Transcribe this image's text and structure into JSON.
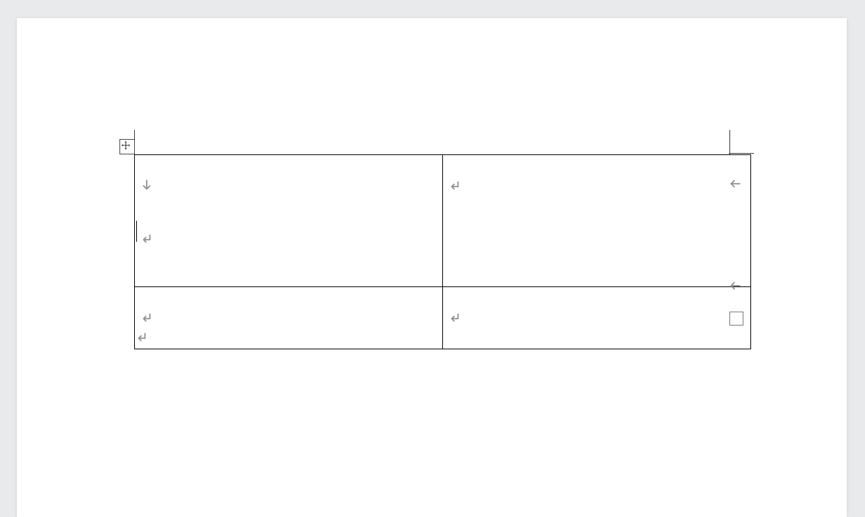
{
  "document": {
    "table": {
      "rows": 2,
      "cols": 2,
      "cells": [
        [
          {
            "marks": [
              "newline-down",
              "pilcrow-return"
            ]
          },
          {
            "marks": [
              "pilcrow-return"
            ]
          }
        ],
        [
          {
            "marks": [
              "pilcrow-return"
            ]
          },
          {
            "marks": [
              "pilcrow-return"
            ]
          }
        ]
      ],
      "row_end_marks": [
        "row-end-arrow",
        "row-end-arrow"
      ]
    },
    "trailing_paragraph_mark": "pilcrow-return",
    "move_handle_label": "table-move-handle",
    "resize_handle_label": "table-resize-handle"
  }
}
